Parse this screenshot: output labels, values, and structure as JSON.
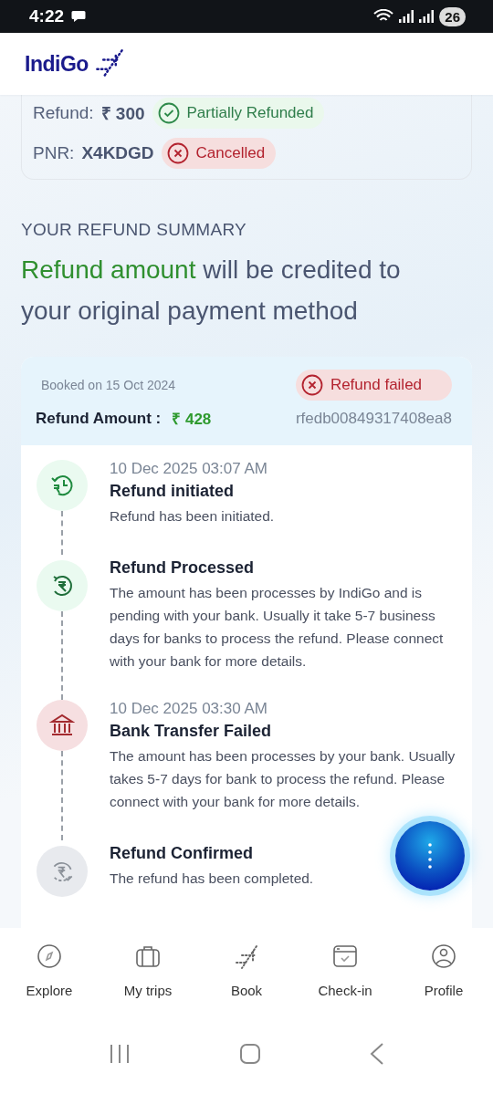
{
  "status_bar": {
    "time": "4:22",
    "battery": "26"
  },
  "header": {
    "logo": "IndiGo"
  },
  "booking": {
    "refund_label": "Refund:",
    "refund_value": "₹ 300",
    "refund_status": {
      "kind": "success",
      "label": "Partially Refunded"
    },
    "pnr_label": "PNR:",
    "pnr_value": "X4KDGD",
    "pnr_status": {
      "kind": "error",
      "label": "Cancelled"
    }
  },
  "summary": {
    "eyebrow": "YOUR REFUND SUMMARY",
    "headline_highlight": "Refund amount",
    "headline_rest": "will be credited to your original payment method"
  },
  "refund_card": {
    "booked": "Booked on 15 Oct 2024",
    "status": {
      "kind": "error",
      "label": "Refund failed"
    },
    "amount_label": "Refund Amount :",
    "amount_value": "₹ 428",
    "reference": "rfedb00849317408ea8",
    "steps": [
      {
        "kind": "done",
        "date": "10 Dec 2025 03:07 AM",
        "title": "Refund initiated",
        "text": "Refund has been initiated."
      },
      {
        "kind": "done",
        "title": "Refund Processed",
        "text": "The amount has been processes by IndiGo and is pending with your bank. Usually it take 5-7 business days for banks to process the refund. Please connect with your bank for more details."
      },
      {
        "kind": "failed",
        "date": "10 Dec 2025 03:30 AM",
        "title": "Bank Transfer Failed",
        "text": "The amount has been processes by your bank. Usually takes 5-7 days for bank to process the refund. Please connect with your bank for more details."
      },
      {
        "kind": "pending",
        "title": "Refund Confirmed",
        "text": "The refund has been completed."
      }
    ]
  },
  "bottom_nav": [
    {
      "label": "Explore"
    },
    {
      "label": "My trips"
    },
    {
      "label": "Book"
    },
    {
      "label": "Check-in"
    },
    {
      "label": "Profile"
    }
  ]
}
